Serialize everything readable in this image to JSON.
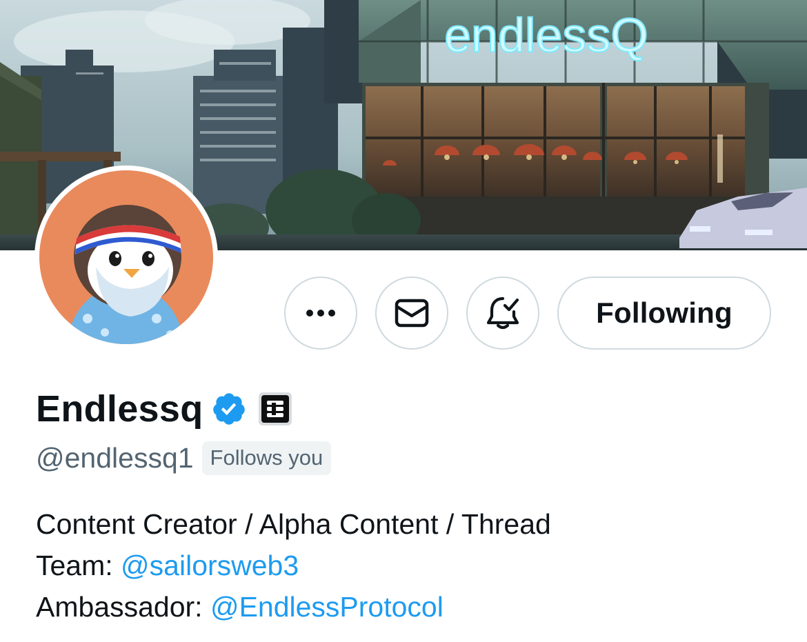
{
  "banner": {
    "sign_text": "endlessQ"
  },
  "profile": {
    "display_name": "Endlessq",
    "handle": "@endlessq1",
    "follows_you_label": "Follows you"
  },
  "actions": {
    "more_icon": "more-horizontal-icon",
    "message_icon": "envelope-icon",
    "notify_icon": "bell-check-icon",
    "following_label": "Following"
  },
  "bio": {
    "line1": "Content Creator / Alpha Content / Thread",
    "team_label": "Team: ",
    "team_mention": "@sailorsweb3",
    "ambassador_label": "Ambassador: ",
    "ambassador_mention": "@EndlessProtocol"
  },
  "colors": {
    "accent": "#1d9bf0",
    "verified": "#1d9bf0",
    "secondary_text": "#536471",
    "border": "#cfd9de",
    "avatar_bg": "#e98a5c"
  }
}
